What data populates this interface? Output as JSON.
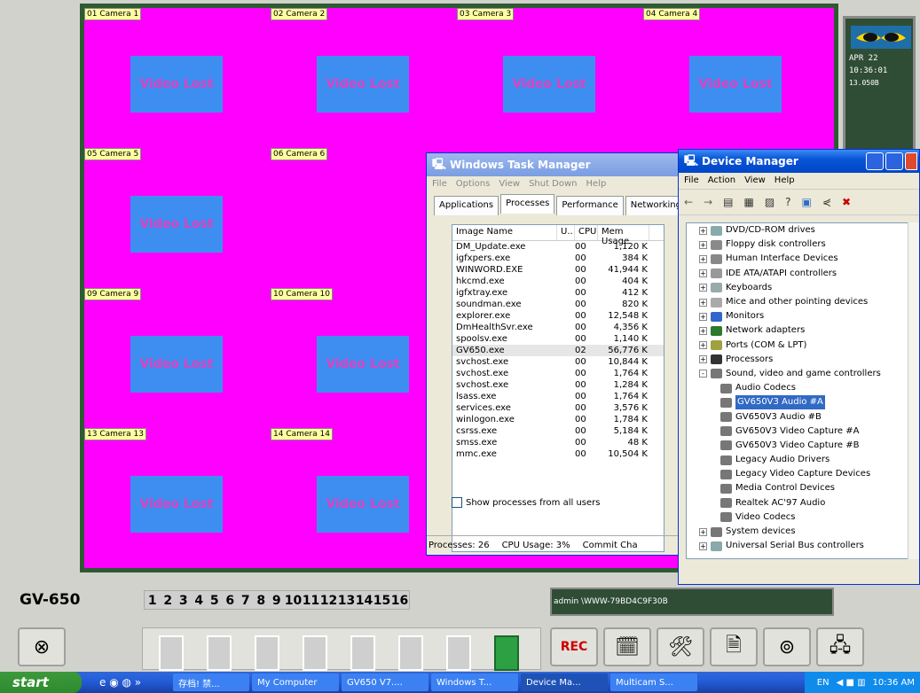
{
  "cameras": [
    {
      "label": "01 Camera 1",
      "status": "Video Lost"
    },
    {
      "label": "02 Camera 2",
      "status": "Video Lost"
    },
    {
      "label": "03 Camera 3",
      "status": "Video Lost"
    },
    {
      "label": "04 Camera 4",
      "status": "Video Lost"
    },
    {
      "label": "05 Camera 5",
      "status": "Video Lost"
    },
    {
      "label": "06 Camera 6",
      "status": ""
    },
    {
      "label": "09 Camera 9",
      "status": "Video Lost"
    },
    {
      "label": "10 Camera 10",
      "status": "Video Lost"
    },
    {
      "label": "13 Camera 13",
      "status": "Video Lost"
    },
    {
      "label": "14 Camera 14",
      "status": "Video Lost"
    }
  ],
  "sidebox": {
    "date": "APR 22",
    "time": "10:36:01",
    "value": "13.050B"
  },
  "app": {
    "name": "GV-650",
    "user_status": "admin \\WWW-79BD4C9F30B"
  },
  "channel_numbers": [
    "1",
    "2",
    "3",
    "4",
    "5",
    "6",
    "7",
    "8",
    "9",
    "10",
    "11",
    "12",
    "13",
    "14",
    "15",
    "16"
  ],
  "taskmgr": {
    "title": "Windows Task Manager",
    "menu": [
      "File",
      "Options",
      "View",
      "Shut Down",
      "Help"
    ],
    "tabs": [
      "Applications",
      "Processes",
      "Performance",
      "Networking"
    ],
    "columns": [
      "Image Name",
      "U..",
      "CPU",
      "Mem Usage"
    ],
    "rows": [
      {
        "name": "DM_Update.exe",
        "cpu": "00",
        "mem": "1,120 K"
      },
      {
        "name": "igfxpers.exe",
        "cpu": "00",
        "mem": "384 K"
      },
      {
        "name": "WINWORD.EXE",
        "cpu": "00",
        "mem": "41,944 K"
      },
      {
        "name": "hkcmd.exe",
        "cpu": "00",
        "mem": "404 K"
      },
      {
        "name": "igfxtray.exe",
        "cpu": "00",
        "mem": "412 K"
      },
      {
        "name": "soundman.exe",
        "cpu": "00",
        "mem": "820 K"
      },
      {
        "name": "explorer.exe",
        "cpu": "00",
        "mem": "12,548 K"
      },
      {
        "name": "DmHealthSvr.exe",
        "cpu": "00",
        "mem": "4,356 K"
      },
      {
        "name": "spoolsv.exe",
        "cpu": "00",
        "mem": "1,140 K"
      },
      {
        "name": "GV650.exe",
        "cpu": "02",
        "mem": "56,776 K"
      },
      {
        "name": "svchost.exe",
        "cpu": "00",
        "mem": "10,844 K"
      },
      {
        "name": "svchost.exe",
        "cpu": "00",
        "mem": "1,764 K"
      },
      {
        "name": "svchost.exe",
        "cpu": "00",
        "mem": "1,284 K"
      },
      {
        "name": "lsass.exe",
        "cpu": "00",
        "mem": "1,764 K"
      },
      {
        "name": "services.exe",
        "cpu": "00",
        "mem": "3,576 K"
      },
      {
        "name": "winlogon.exe",
        "cpu": "00",
        "mem": "1,784 K"
      },
      {
        "name": "csrss.exe",
        "cpu": "00",
        "mem": "5,184 K"
      },
      {
        "name": "smss.exe",
        "cpu": "00",
        "mem": "48 K"
      },
      {
        "name": "mmc.exe",
        "cpu": "00",
        "mem": "10,504 K"
      }
    ],
    "show_all": "Show processes from all users",
    "status_processes": "Processes: 26",
    "status_cpu": "CPU Usage: 3%",
    "status_commit": "Commit Cha"
  },
  "devmgr": {
    "title": "Device Manager",
    "menu": [
      "File",
      "Action",
      "View",
      "Help"
    ],
    "items": [
      {
        "label": "DVD/CD-ROM drives",
        "level": 0,
        "exp": "+"
      },
      {
        "label": "Floppy disk controllers",
        "level": 0,
        "exp": "+"
      },
      {
        "label": "Human Interface Devices",
        "level": 0,
        "exp": "+"
      },
      {
        "label": "IDE ATA/ATAPI controllers",
        "level": 0,
        "exp": "+"
      },
      {
        "label": "Keyboards",
        "level": 0,
        "exp": "+"
      },
      {
        "label": "Mice and other pointing devices",
        "level": 0,
        "exp": "+"
      },
      {
        "label": "Monitors",
        "level": 0,
        "exp": "+"
      },
      {
        "label": "Network adapters",
        "level": 0,
        "exp": "+"
      },
      {
        "label": "Ports (COM & LPT)",
        "level": 0,
        "exp": "+"
      },
      {
        "label": "Processors",
        "level": 0,
        "exp": "+"
      },
      {
        "label": "Sound, video and game controllers",
        "level": 0,
        "exp": "-"
      },
      {
        "label": "Audio Codecs",
        "level": 1,
        "exp": ""
      },
      {
        "label": "GV650V3 Audio #A",
        "level": 1,
        "exp": "",
        "sel": true
      },
      {
        "label": "GV650V3 Audio #B",
        "level": 1,
        "exp": ""
      },
      {
        "label": "GV650V3 Video Capture #A",
        "level": 1,
        "exp": ""
      },
      {
        "label": "GV650V3 Video Capture #B",
        "level": 1,
        "exp": ""
      },
      {
        "label": "Legacy Audio Drivers",
        "level": 1,
        "exp": ""
      },
      {
        "label": "Legacy Video Capture Devices",
        "level": 1,
        "exp": ""
      },
      {
        "label": "Media Control Devices",
        "level": 1,
        "exp": ""
      },
      {
        "label": "Realtek AC'97 Audio",
        "level": 1,
        "exp": ""
      },
      {
        "label": "Video Codecs",
        "level": 1,
        "exp": ""
      },
      {
        "label": "System devices",
        "level": 0,
        "exp": "+"
      },
      {
        "label": "Universal Serial Bus controllers",
        "level": 0,
        "exp": "+"
      }
    ]
  },
  "taskbar": {
    "start": "start",
    "buttons": [
      "存档! 禁...",
      "My Computer",
      "GV650 V7....",
      "Windows T...",
      "Device Ma...",
      "Multicam S..."
    ],
    "lang": "EN",
    "clock": "10:36 AM"
  }
}
